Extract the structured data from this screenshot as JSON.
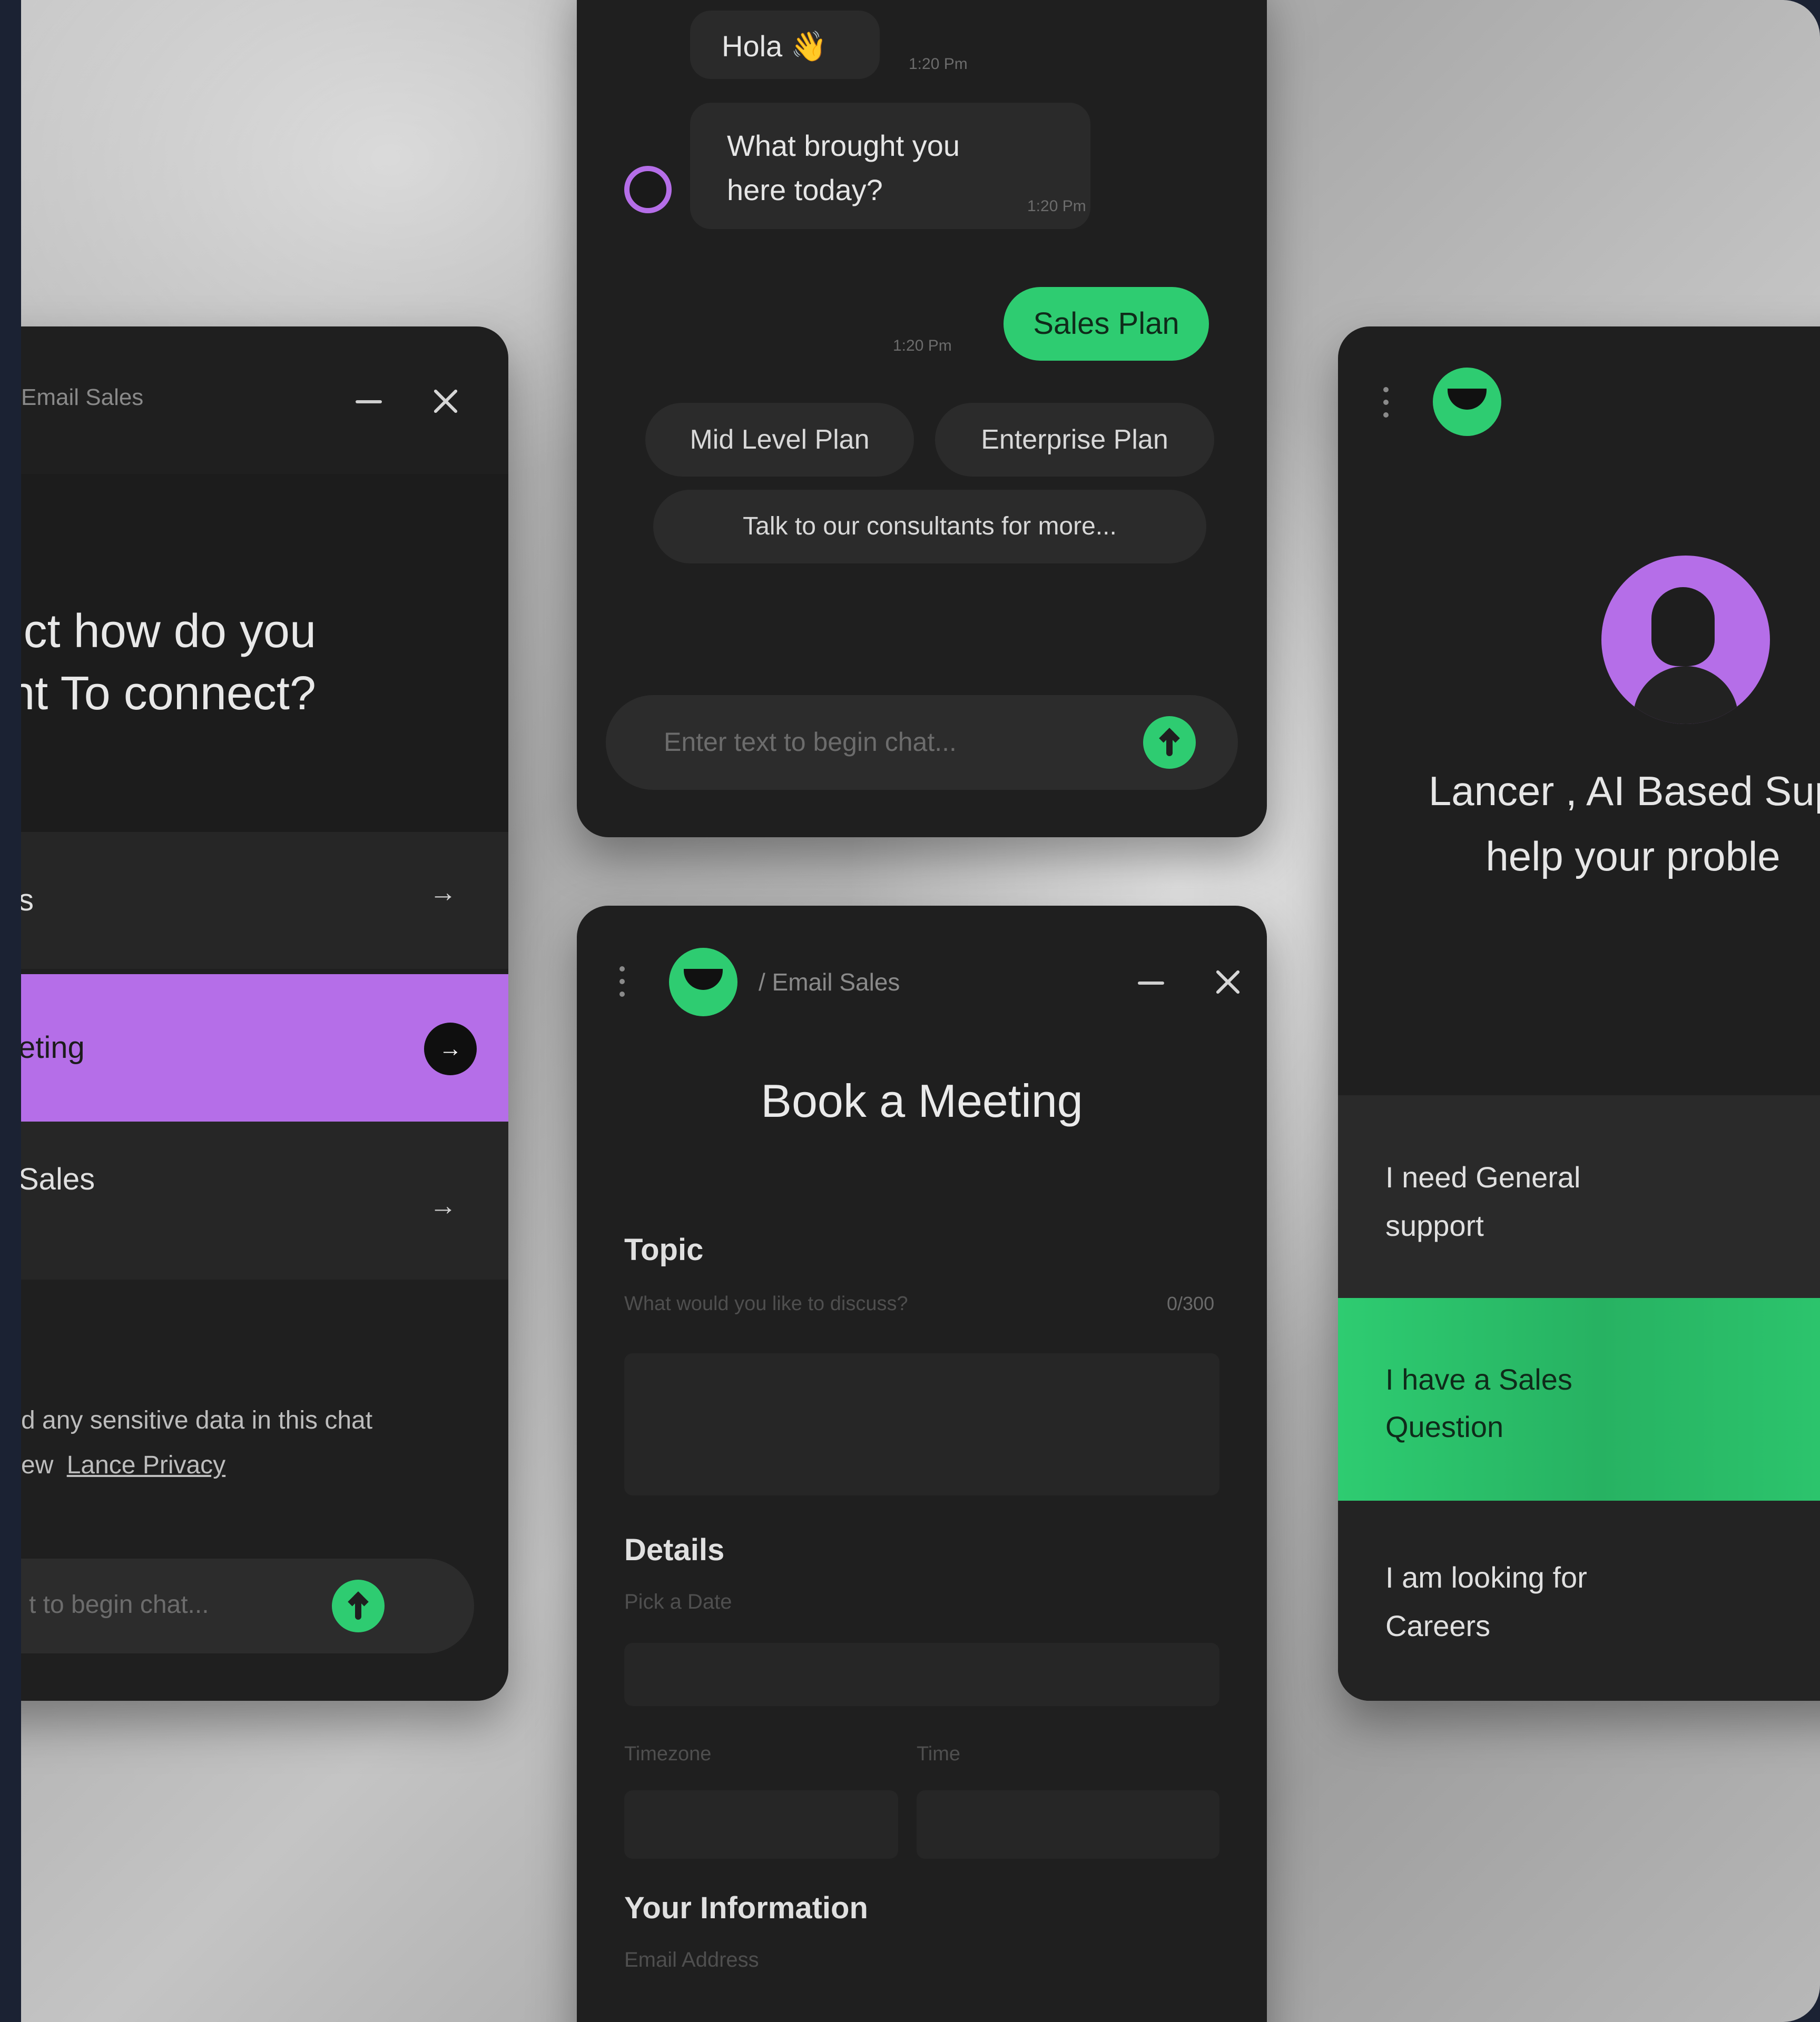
{
  "colors": {
    "accent_green": "#2ecc71",
    "accent_purple": "#b56ee8",
    "card_bg": "#1f1f1f"
  },
  "chat": {
    "greeting": "Hola 👋",
    "greeting_time": "1:20 Pm",
    "question": "What brought you here today?",
    "question_time": "1:20 Pm",
    "user_reply": "Sales Plan",
    "user_reply_time": "1:20 Pm",
    "chips": [
      "Mid Level Plan",
      "Enterprise Plan",
      "Talk to our consultants for more..."
    ],
    "input_placeholder": "Enter text to begin chat..."
  },
  "connect": {
    "header_label": "Email Sales",
    "title": "ct how do you want To connect?",
    "options": [
      "s",
      "eting",
      "Sales"
    ],
    "privacy_note": "d any sensitive data in this chat",
    "privacy_prefix": "ew",
    "privacy_link": "Lance Privacy",
    "input_placeholder": "t to begin chat..."
  },
  "meeting": {
    "breadcrumb": "/ Email Sales",
    "title": "Book a Meeting",
    "topic_label": "Topic",
    "topic_hint": "What would you like to discuss?",
    "topic_counter": "0/300",
    "details_label": "Details",
    "date_hint": "Pick a Date",
    "timezone_hint": "Timezone",
    "time_hint": "Time",
    "info_label": "Your Information",
    "email_hint": "Email Address"
  },
  "support": {
    "intro": "Lancer , AI Based Sup help your proble",
    "options": [
      "I need General support",
      "I have a Sales Question",
      "I am looking for Careers"
    ]
  }
}
